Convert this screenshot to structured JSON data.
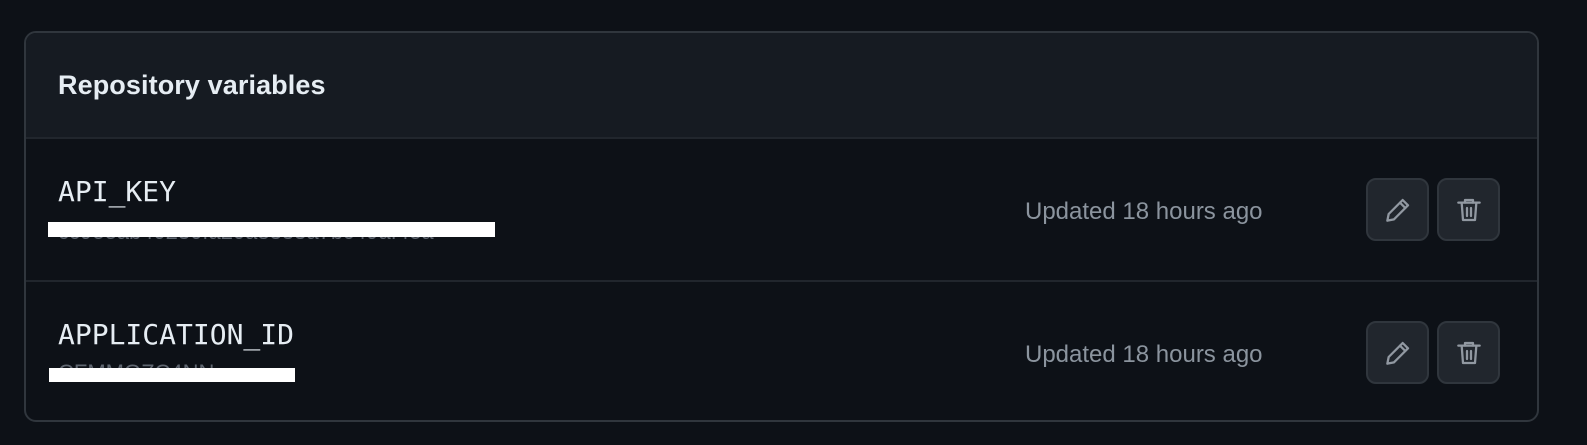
{
  "panel": {
    "title": "Repository variables"
  },
  "variables": [
    {
      "name": "API_KEY",
      "value": "cc9eeab40230fa20a8333a7bc49af4ea",
      "updated": "Updated 18 hours ago",
      "edit_icon": "pencil-icon",
      "delete_icon": "trash-icon"
    },
    {
      "name": "APPLICATION_ID",
      "value": "CFMMGZC4NN",
      "updated": "Updated 18 hours ago",
      "edit_icon": "pencil-icon",
      "delete_icon": "trash-icon"
    }
  ],
  "colors": {
    "page_background": "#0d1117",
    "header_background": "#161b22",
    "border": "#30363d",
    "text_primary": "#e6edf3",
    "text_muted": "#8b949e",
    "redaction": "#ffffff"
  }
}
